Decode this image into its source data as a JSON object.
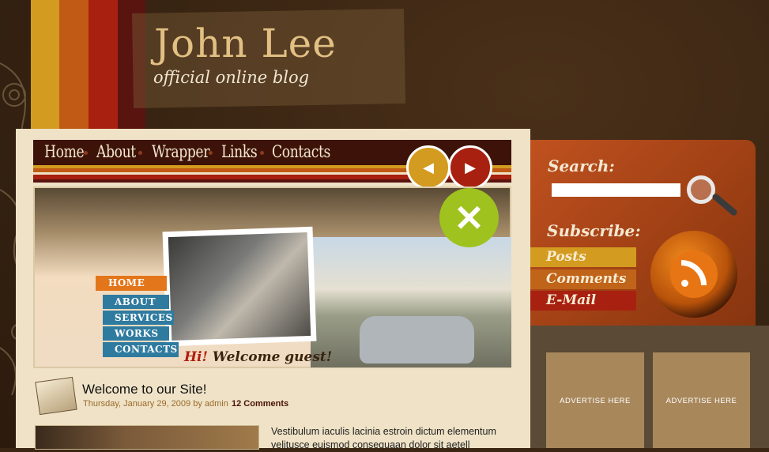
{
  "header": {
    "title": "John Lee",
    "tagline": "official online blog"
  },
  "nav": {
    "items": [
      "Home",
      "About",
      "Wrapper",
      "Links",
      "Contacts"
    ],
    "prev_icon": "chevron-left-icon",
    "next_icon": "chevron-right-icon"
  },
  "hero": {
    "menu": [
      "HOME",
      "ABOUT",
      "SERVICES",
      "WORKS",
      "CONTACTS"
    ],
    "welcome_hi": "Hi!",
    "welcome_rest": "Welcome guest!"
  },
  "post": {
    "title": "Welcome to our Site!",
    "meta": "Thursday, January 29, 2009 by admin",
    "comments": "12 Comments",
    "excerpt": "Vestibulum iaculis lacinia estroin dictum elementum velitusce euismod consequaan dolor sit aetell"
  },
  "sidebar": {
    "search_label": "Search:",
    "subscribe_label": "Subscribe:",
    "subscribe_items": [
      "Posts",
      "Comments",
      "E-Mail"
    ],
    "ads": [
      "ADVERTISE HERE",
      "ADVERTISE HERE"
    ]
  },
  "colors": {
    "stripe_yellow": "#d39b1f",
    "stripe_orange": "#c05a14",
    "stripe_red": "#a8200f",
    "nav_bg": "#3d1309",
    "sidebar_orange": "#b04818"
  }
}
